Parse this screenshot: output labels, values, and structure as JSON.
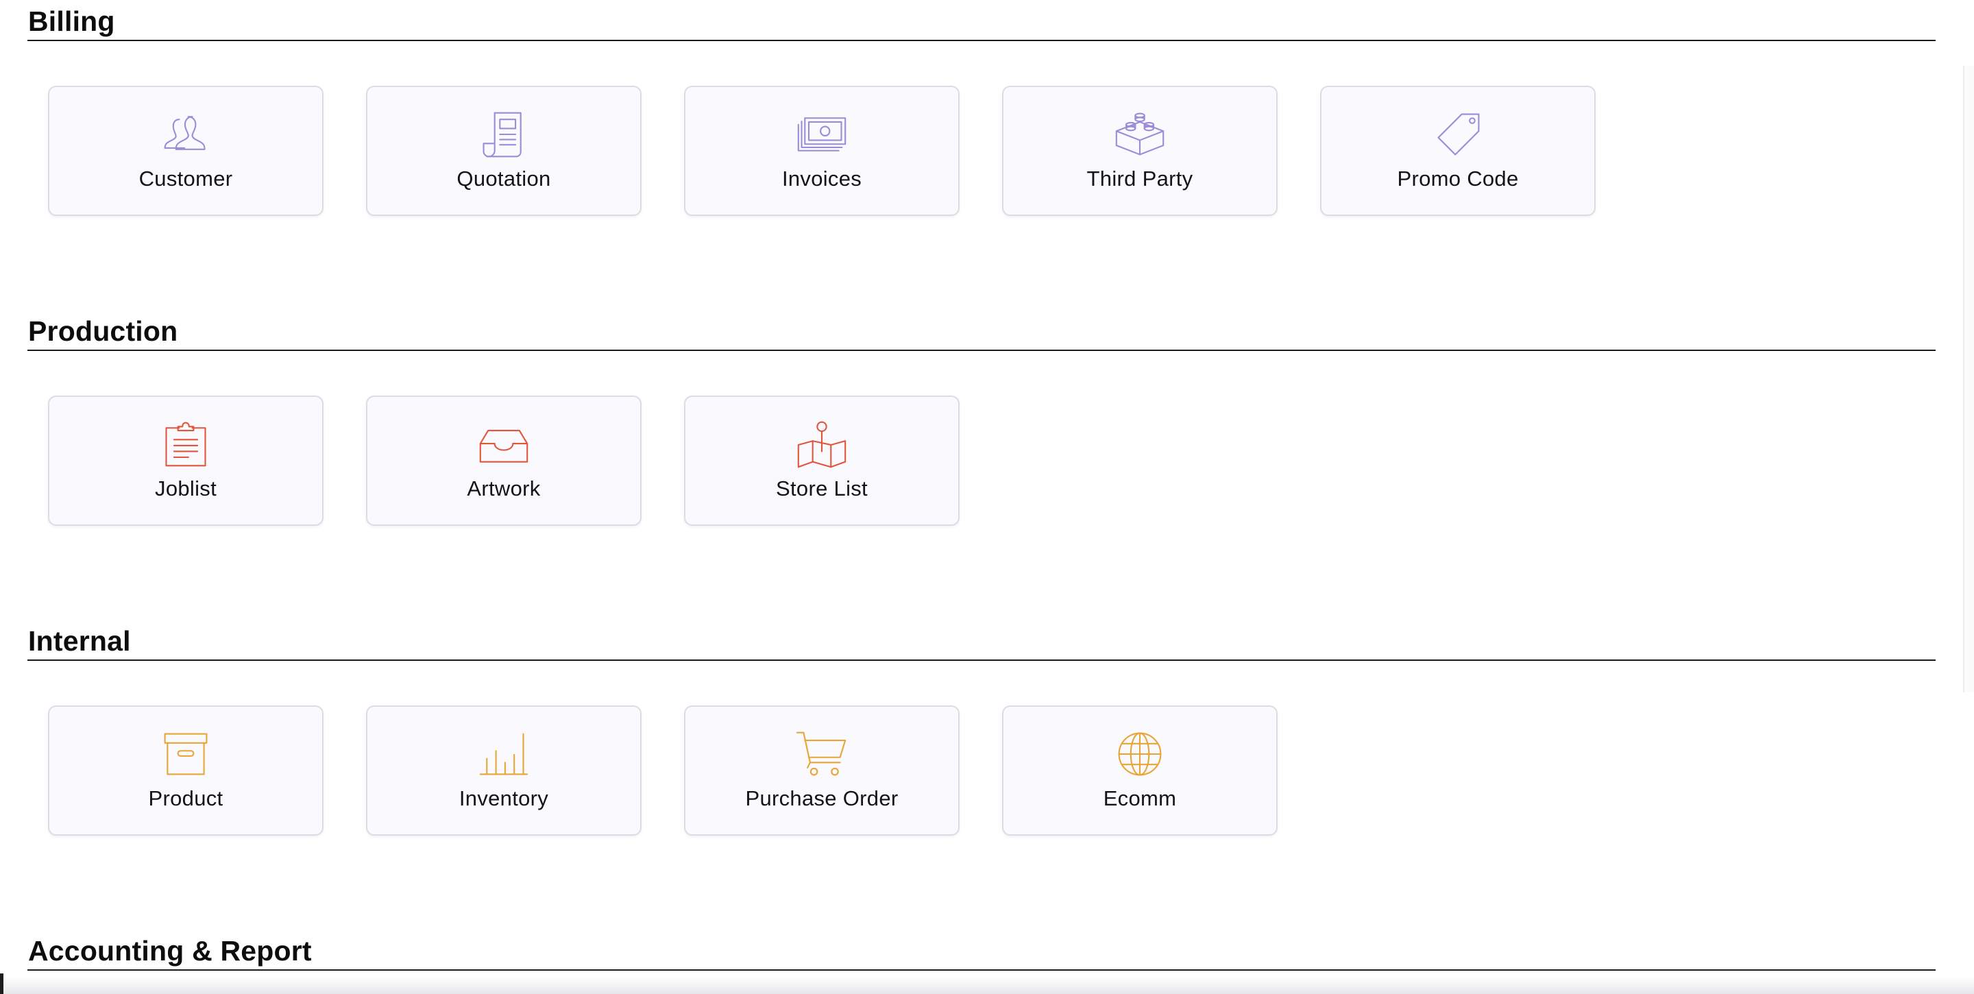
{
  "colors": {
    "billing_icon": "#9b8bd8",
    "production_icon": "#e2553a",
    "internal_icon": "#e8a534",
    "heading_text": "#0d0d0d",
    "tile_background": "#f9f9fe",
    "tile_border": "#dcdce6"
  },
  "sections": [
    {
      "title": "Billing",
      "items": [
        {
          "label": "Customer",
          "icon": "users-icon"
        },
        {
          "label": "Quotation",
          "icon": "document-icon"
        },
        {
          "label": "Invoices",
          "icon": "cash-stack-icon"
        },
        {
          "label": "Third Party",
          "icon": "building-blocks-icon"
        },
        {
          "label": "Promo Code",
          "icon": "price-tag-icon"
        }
      ]
    },
    {
      "title": "Production",
      "items": [
        {
          "label": "Joblist",
          "icon": "clipboard-icon"
        },
        {
          "label": "Artwork",
          "icon": "inbox-tray-icon"
        },
        {
          "label": "Store List",
          "icon": "map-pin-icon"
        }
      ]
    },
    {
      "title": "Internal",
      "items": [
        {
          "label": "Product",
          "icon": "archive-box-icon"
        },
        {
          "label": "Inventory",
          "icon": "bar-chart-icon"
        },
        {
          "label": "Purchase Order",
          "icon": "shopping-cart-icon"
        },
        {
          "label": "Ecomm",
          "icon": "globe-icon"
        }
      ]
    },
    {
      "title": "Accounting & Report",
      "items": []
    }
  ]
}
